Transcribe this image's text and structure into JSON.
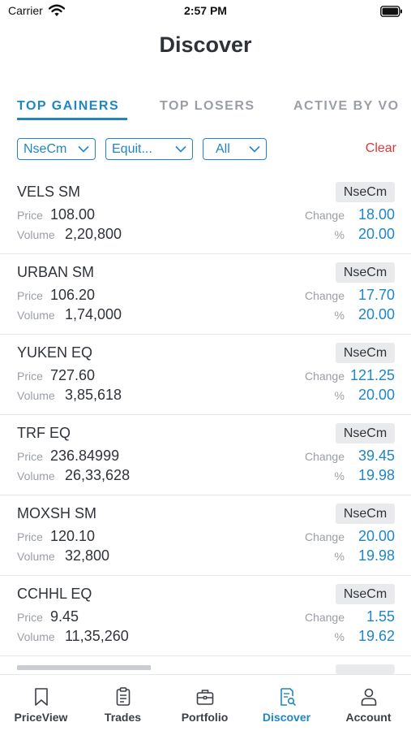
{
  "status_bar": {
    "carrier": "Carrier",
    "time": "2:57 PM"
  },
  "header": {
    "title": "Discover"
  },
  "tabs": [
    {
      "label": "TOP GAINERS",
      "active": true
    },
    {
      "label": "TOP LOSERS",
      "active": false
    },
    {
      "label": "ACTIVE BY VO",
      "active": false
    }
  ],
  "filters": {
    "exchange": "NseCm",
    "segment": "Equit...",
    "group": "All",
    "clear_label": "Clear"
  },
  "labels": {
    "price": "Price",
    "volume": "Volume",
    "change": "Change",
    "percent": "%"
  },
  "stocks": [
    {
      "symbol": "VELS SM",
      "price": "108.00",
      "volume": "2,20,800",
      "exchange": "NseCm",
      "change": "18.00",
      "percent": "20.00"
    },
    {
      "symbol": "URBAN SM",
      "price": "106.20",
      "volume": "1,74,000",
      "exchange": "NseCm",
      "change": "17.70",
      "percent": "20.00"
    },
    {
      "symbol": "YUKEN EQ",
      "price": "727.60",
      "volume": "3,85,618",
      "exchange": "NseCm",
      "change": "121.25",
      "percent": "20.00"
    },
    {
      "symbol": "TRF EQ",
      "price": "236.84999",
      "volume": "26,33,628",
      "exchange": "NseCm",
      "change": "39.45",
      "percent": "19.98"
    },
    {
      "symbol": "MOXSH SM",
      "price": "120.10",
      "volume": "32,800",
      "exchange": "NseCm",
      "change": "20.00",
      "percent": "19.98"
    },
    {
      "symbol": "CCHHL EQ",
      "price": "9.45",
      "volume": "11,35,260",
      "exchange": "NseCm",
      "change": "1.55",
      "percent": "19.62"
    }
  ],
  "bottom_nav": [
    {
      "label": "PriceView",
      "icon": "bookmark-icon",
      "active": false
    },
    {
      "label": "Trades",
      "icon": "clipboard-icon",
      "active": false
    },
    {
      "label": "Portfolio",
      "icon": "briefcase-icon",
      "active": false
    },
    {
      "label": "Discover",
      "icon": "document-search-icon",
      "active": true
    },
    {
      "label": "Account",
      "icon": "person-icon",
      "active": false
    }
  ],
  "colors": {
    "accent": "#1f86c6",
    "clear": "#d8393a",
    "muted": "#9a9ea5",
    "text": "#2f333a"
  }
}
